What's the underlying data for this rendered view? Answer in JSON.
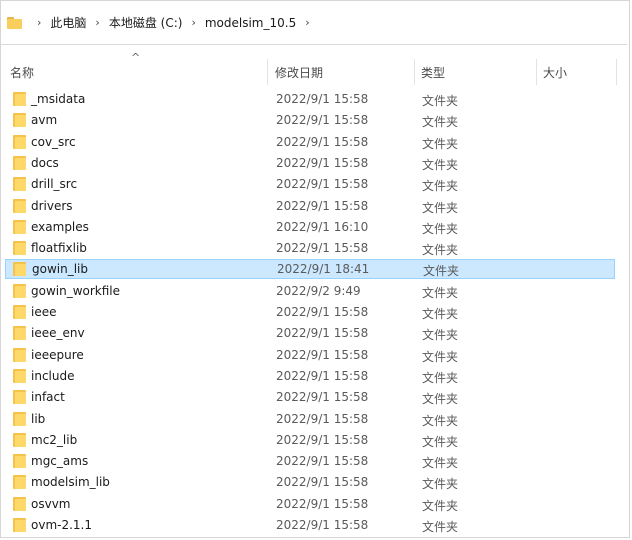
{
  "breadcrumb": [
    "此电脑",
    "本地磁盘 (C:)",
    "modelsim_10.5"
  ],
  "columns": {
    "name": "名称",
    "modified": "修改日期",
    "type": "类型",
    "size": "大小"
  },
  "files": [
    {
      "name": "_msidata",
      "date": "2022/9/1 15:58",
      "type": "文件夹"
    },
    {
      "name": "avm",
      "date": "2022/9/1 15:58",
      "type": "文件夹"
    },
    {
      "name": "cov_src",
      "date": "2022/9/1 15:58",
      "type": "文件夹"
    },
    {
      "name": "docs",
      "date": "2022/9/1 15:58",
      "type": "文件夹"
    },
    {
      "name": "drill_src",
      "date": "2022/9/1 15:58",
      "type": "文件夹"
    },
    {
      "name": "drivers",
      "date": "2022/9/1 15:58",
      "type": "文件夹"
    },
    {
      "name": "examples",
      "date": "2022/9/1 16:10",
      "type": "文件夹"
    },
    {
      "name": "floatfixlib",
      "date": "2022/9/1 15:58",
      "type": "文件夹"
    },
    {
      "name": "gowin_lib",
      "date": "2022/9/1 18:41",
      "type": "文件夹",
      "selected": true
    },
    {
      "name": "gowin_workfile",
      "date": "2022/9/2 9:49",
      "type": "文件夹"
    },
    {
      "name": "ieee",
      "date": "2022/9/1 15:58",
      "type": "文件夹"
    },
    {
      "name": "ieee_env",
      "date": "2022/9/1 15:58",
      "type": "文件夹"
    },
    {
      "name": "ieeepure",
      "date": "2022/9/1 15:58",
      "type": "文件夹"
    },
    {
      "name": "include",
      "date": "2022/9/1 15:58",
      "type": "文件夹"
    },
    {
      "name": "infact",
      "date": "2022/9/1 15:58",
      "type": "文件夹"
    },
    {
      "name": "lib",
      "date": "2022/9/1 15:58",
      "type": "文件夹"
    },
    {
      "name": "mc2_lib",
      "date": "2022/9/1 15:58",
      "type": "文件夹"
    },
    {
      "name": "mgc_ams",
      "date": "2022/9/1 15:58",
      "type": "文件夹"
    },
    {
      "name": "modelsim_lib",
      "date": "2022/9/1 15:58",
      "type": "文件夹"
    },
    {
      "name": "osvvm",
      "date": "2022/9/1 15:58",
      "type": "文件夹"
    },
    {
      "name": "ovm-2.1.1",
      "date": "2022/9/1 15:58",
      "type": "文件夹"
    }
  ]
}
